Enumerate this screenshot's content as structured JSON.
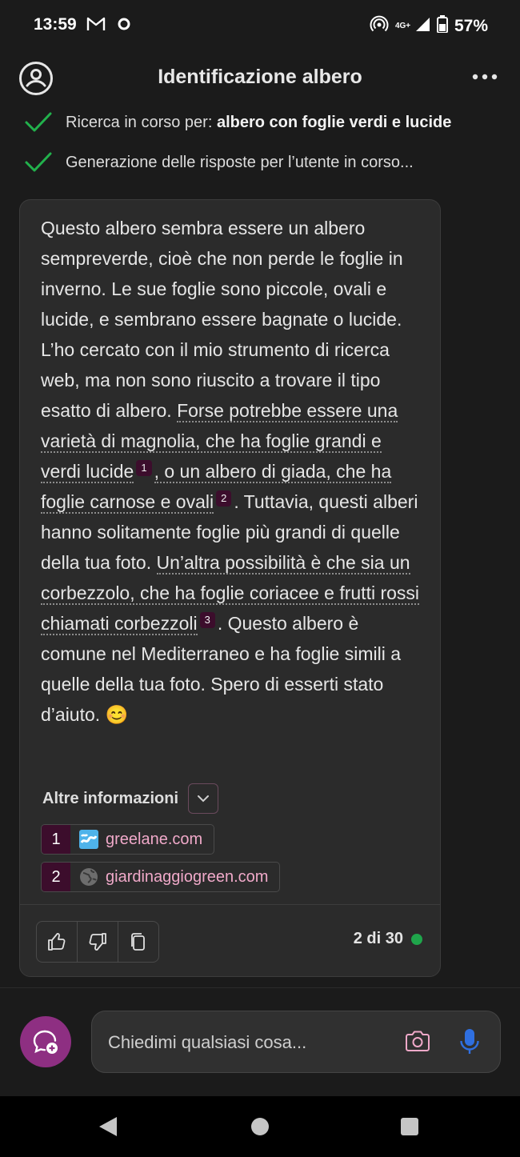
{
  "status_bar": {
    "time": "13:59",
    "network": "4G+",
    "battery": "57%",
    "icons": [
      "gmail-icon",
      "circle-notification-icon",
      "hotspot-icon",
      "signal-icon",
      "battery-icon"
    ]
  },
  "header": {
    "title": "Identificazione albero"
  },
  "steps": [
    {
      "prefix": "Ricerca in corso per: ",
      "bold": "albero con foglie verdi e lucide"
    },
    {
      "prefix": "Generazione delle risposte per l’utente in corso...",
      "bold": ""
    }
  ],
  "message": {
    "p1": "Questo albero sembra essere un albero sempreverde, cioè che non perde le foglie in inverno. Le sue foglie sono piccole, ovali e lucide, e sembrano essere bagnate o lucide. L’ho cercato con il mio strumento di ricerca web, ma non sono riuscito a trovare il tipo esatto di albero. ",
    "cite1": "Forse potrebbe essere una varietà di magnolia, che ha foglie grandi e verdi lucide",
    "sup1": "1",
    "cite2": ", o un albero di giada, che ha foglie carnose e ovali",
    "sup2": "2",
    "p2": ". Tuttavia, questi alberi hanno solitamente foglie più grandi di quelle della tua foto. ",
    "cite3": "Un’altra possibilità è che sia un corbezzolo, che ha foglie coriacee e frutti rossi chiamati corbezzoli",
    "sup3": "3",
    "p3": ". Questo albero è comune nel Mediterraneo e ha foglie simili a quelle della tua foto. Spero di esserti stato d’aiuto. 😊"
  },
  "more_info": {
    "label": "Altre informazioni"
  },
  "sources": [
    {
      "num": "1",
      "domain": "greelane.com",
      "icon": "greelane-favicon-icon"
    },
    {
      "num": "2",
      "domain": "giardinaggiogreen.com",
      "icon": "globe-icon"
    }
  ],
  "footer": {
    "count": "2 di 30",
    "status_color": "#1fa54b"
  },
  "input": {
    "placeholder": "Chiedimi qualsiasi cosa..."
  },
  "colors": {
    "accent": "#8e2f82",
    "citation_bg": "#3c0d2c",
    "link": "#f0a9c9",
    "check": "#22b14c",
    "mic": "#2f6fe0"
  }
}
